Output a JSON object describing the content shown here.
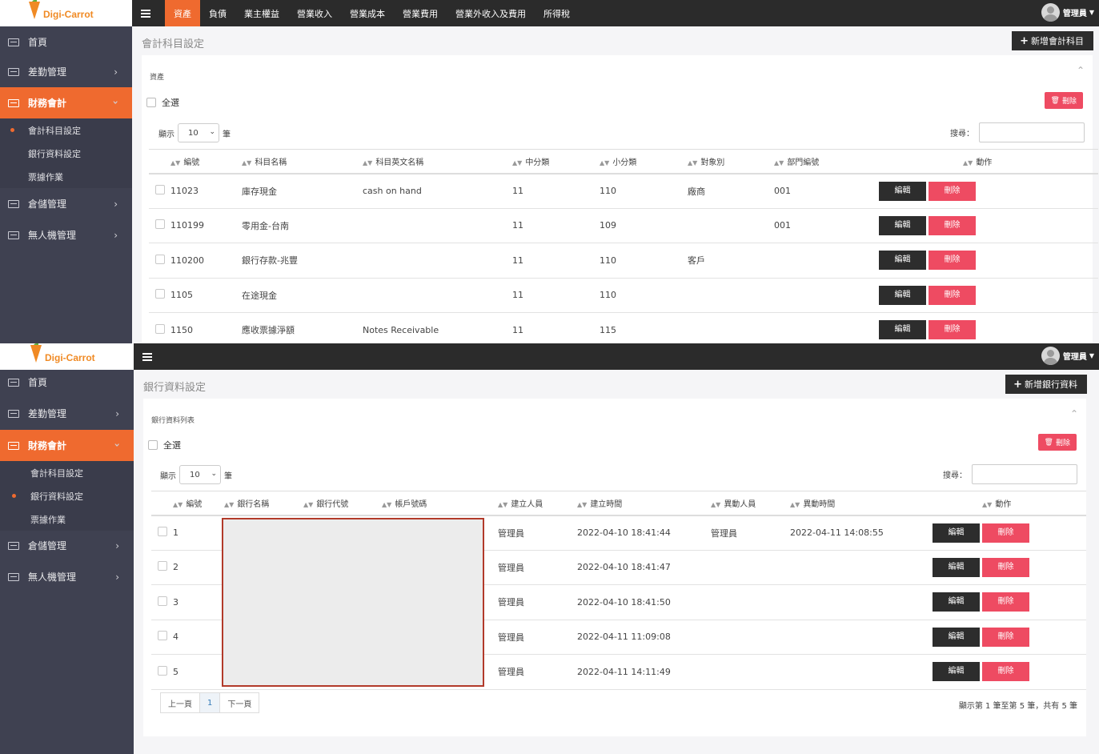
{
  "top": {
    "logo_text": "Digi-Carrot",
    "sidebar": [
      {
        "label": "首頁"
      },
      {
        "label": "差勤管理"
      },
      {
        "label": "財務會計"
      },
      {
        "label": "倉儲管理"
      },
      {
        "label": "無人機管理"
      }
    ],
    "submenu": [
      {
        "label": "會計科目設定"
      },
      {
        "label": "銀行資料設定"
      },
      {
        "label": "票據作業"
      }
    ],
    "nav": [
      {
        "label": "資產"
      },
      {
        "label": "負債"
      },
      {
        "label": "業主權益"
      },
      {
        "label": "營業收入"
      },
      {
        "label": "營業成本"
      },
      {
        "label": "營業費用"
      },
      {
        "label": "營業外收入及費用"
      },
      {
        "label": "所得稅"
      }
    ],
    "user_label": "管理員",
    "page_title": "會計科目設定",
    "add_label": "新增會計科目",
    "card_title": "資產",
    "select_all": "全選",
    "delete_label": "刪除",
    "length_prefix": "顯示",
    "length_value": "10",
    "length_suffix": "筆",
    "search_label": "搜尋：",
    "columns": [
      "編號",
      "科目名稱",
      "科目英文名稱",
      "中分類",
      "小分類",
      "對象別",
      "部門編號",
      "動作"
    ],
    "rows": [
      {
        "id": "11023",
        "name": "庫存現金",
        "en": "cash on hand",
        "mid": "11",
        "sub": "110",
        "target": "廠商",
        "dept": "001"
      },
      {
        "id": "110199",
        "name": "零用金-台南",
        "en": "",
        "mid": "11",
        "sub": "109",
        "target": "",
        "dept": "001"
      },
      {
        "id": "110200",
        "name": "銀行存款-兆豐",
        "en": "",
        "mid": "11",
        "sub": "110",
        "target": "客戶",
        "dept": ""
      },
      {
        "id": "1105",
        "name": "在途現金",
        "en": "",
        "mid": "11",
        "sub": "110",
        "target": "",
        "dept": ""
      },
      {
        "id": "1150",
        "name": "應收票據淨額",
        "en": "Notes Receivable",
        "mid": "11",
        "sub": "115",
        "target": "",
        "dept": ""
      }
    ],
    "edit_label": "編輯",
    "row_delete_label": "刪除"
  },
  "bottom": {
    "logo_text": "Digi-Carrot",
    "sidebar": [
      {
        "label": "首頁"
      },
      {
        "label": "差勤管理"
      },
      {
        "label": "財務會計"
      },
      {
        "label": "倉儲管理"
      },
      {
        "label": "無人機管理"
      }
    ],
    "submenu": [
      {
        "label": "會計科目設定"
      },
      {
        "label": "銀行資料設定"
      },
      {
        "label": "票據作業"
      }
    ],
    "user_label": "管理員",
    "page_title": "銀行資料設定",
    "add_label": "新增銀行資料",
    "card_title": "銀行資料列表",
    "select_all": "全選",
    "delete_label": "刪除",
    "length_prefix": "顯示",
    "length_value": "10",
    "length_suffix": "筆",
    "search_label": "搜尋：",
    "columns": [
      "編號",
      "銀行名稱",
      "銀行代號",
      "帳戶號碼",
      "建立人員",
      "建立時間",
      "異動人員",
      "異動時間",
      "動作"
    ],
    "rows": [
      {
        "id": "1",
        "creator": "管理員",
        "created": "2022-04-10 18:41:44",
        "modifier": "管理員",
        "modified": "2022-04-11 14:08:55"
      },
      {
        "id": "2",
        "creator": "管理員",
        "created": "2022-04-10 18:41:47",
        "modifier": "",
        "modified": ""
      },
      {
        "id": "3",
        "creator": "管理員",
        "created": "2022-04-10 18:41:50",
        "modifier": "",
        "modified": ""
      },
      {
        "id": "4",
        "creator": "管理員",
        "created": "2022-04-11 11:09:08",
        "modifier": "",
        "modified": ""
      },
      {
        "id": "5",
        "creator": "管理員",
        "created": "2022-04-11 14:11:49",
        "modifier": "",
        "modified": ""
      }
    ],
    "edit_label": "編輯",
    "row_delete_label": "刪除",
    "pager": {
      "prev": "上一頁",
      "current": "1",
      "next": "下一頁"
    },
    "info": "顯示第 1 筆至第 5 筆，共有 5 筆"
  },
  "colors": {
    "accent": "#ef6a2f",
    "sidebar": "#3f4151",
    "topbar": "#2b2b2b",
    "danger": "#ee4b62",
    "dark_button": "#2d2d2d"
  }
}
